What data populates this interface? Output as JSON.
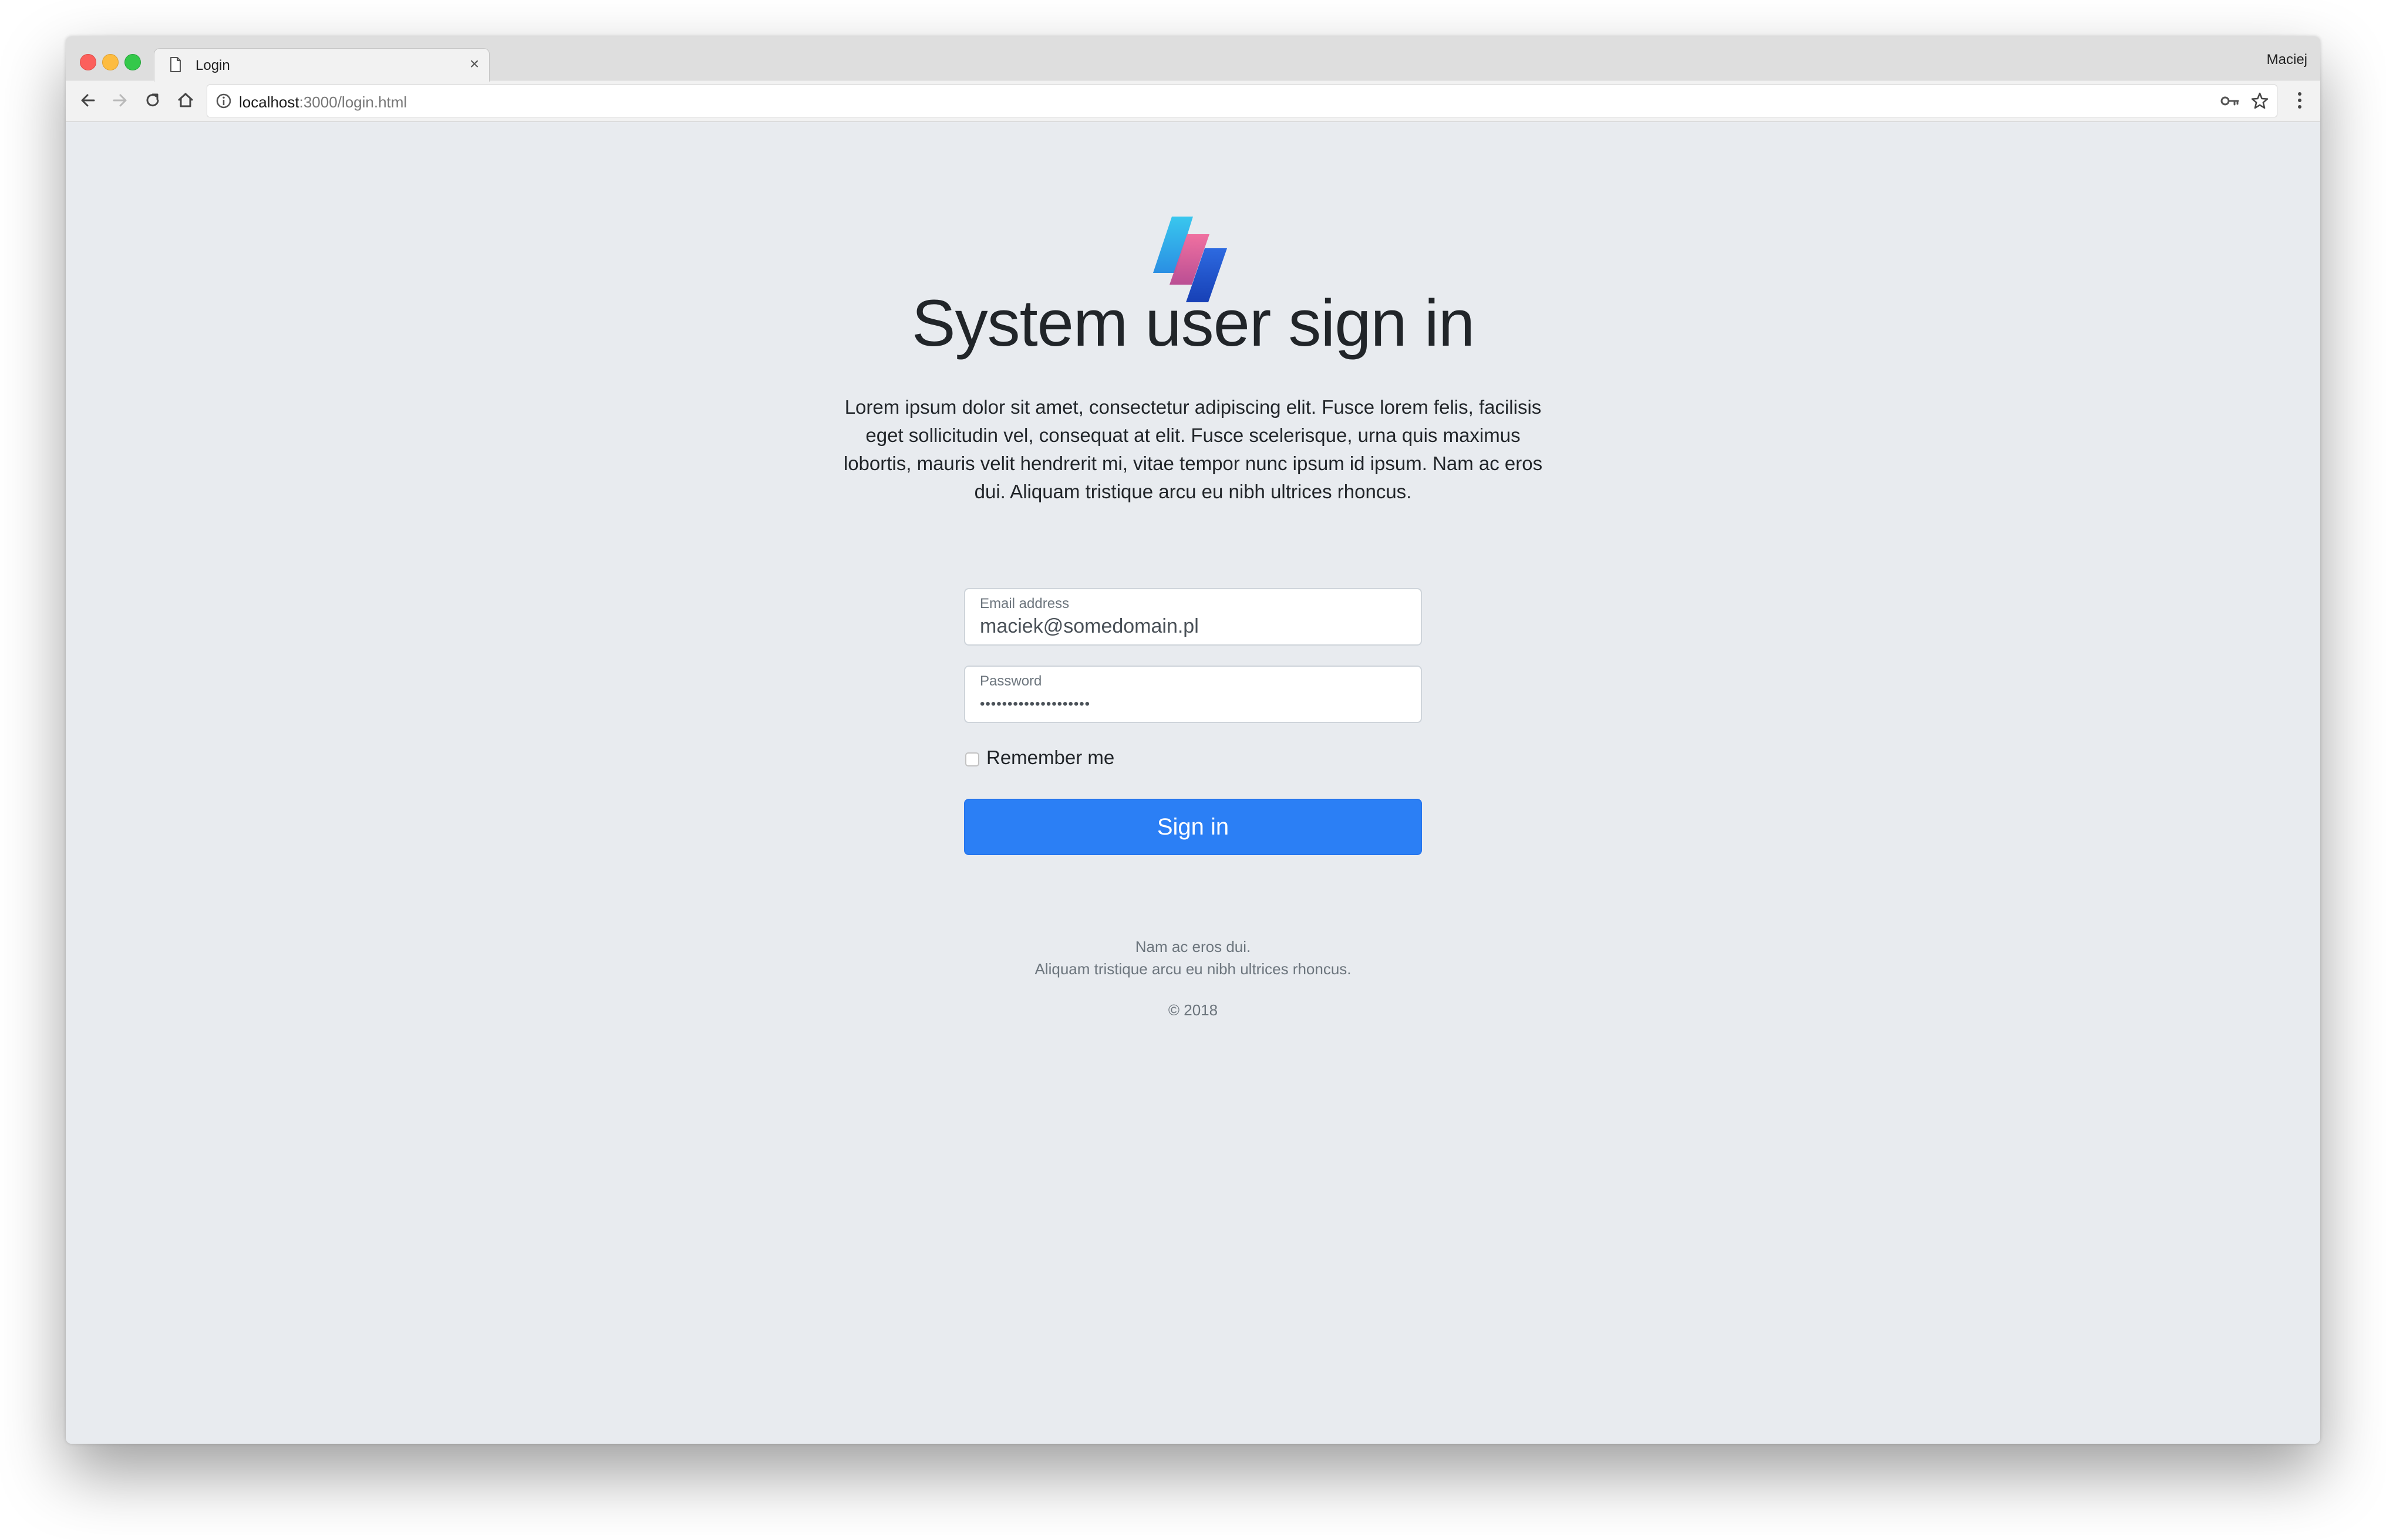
{
  "browser": {
    "tab_title": "Login",
    "profile_name": "Maciej",
    "url_host": "localhost",
    "url_path": ":3000/login.html"
  },
  "page": {
    "title": "System user sign in",
    "description": "Lorem ipsum dolor sit amet, consectetur adipiscing elit. Fusce lorem felis, facilisis eget sollicitudin vel, consequat at elit. Fusce scelerisque, urna quis maximus lobortis, mauris velit hendrerit mi, vitae tempor nunc ipsum id ipsum. Nam ac eros dui. Aliquam tristique arcu eu nibh ultrices rhoncus.",
    "email": {
      "label": "Email address",
      "value": "maciek@somedomain.pl"
    },
    "password": {
      "label": "Password",
      "masked_value": "••••••••••••••••••••"
    },
    "remember_label": "Remember me",
    "remember_checked": false,
    "sign_in_label": "Sign in",
    "footer": {
      "line1": "Nam ac eros dui.",
      "line2": "Aliquam tristique arcu eu nibh ultrices rhoncus.",
      "copyright": "© 2018"
    }
  },
  "colors": {
    "page_background": "#e8ebef",
    "primary_button": "#2b7ff5",
    "logo_cyan": "#2bb8ec",
    "logo_pink": "#e0508c",
    "logo_blue": "#1f52c9"
  },
  "icons": [
    "document-icon",
    "close-icon",
    "back-arrow-icon",
    "forward-arrow-icon",
    "reload-icon",
    "home-icon",
    "info-icon",
    "key-icon",
    "star-icon",
    "menu-dots-icon"
  ]
}
